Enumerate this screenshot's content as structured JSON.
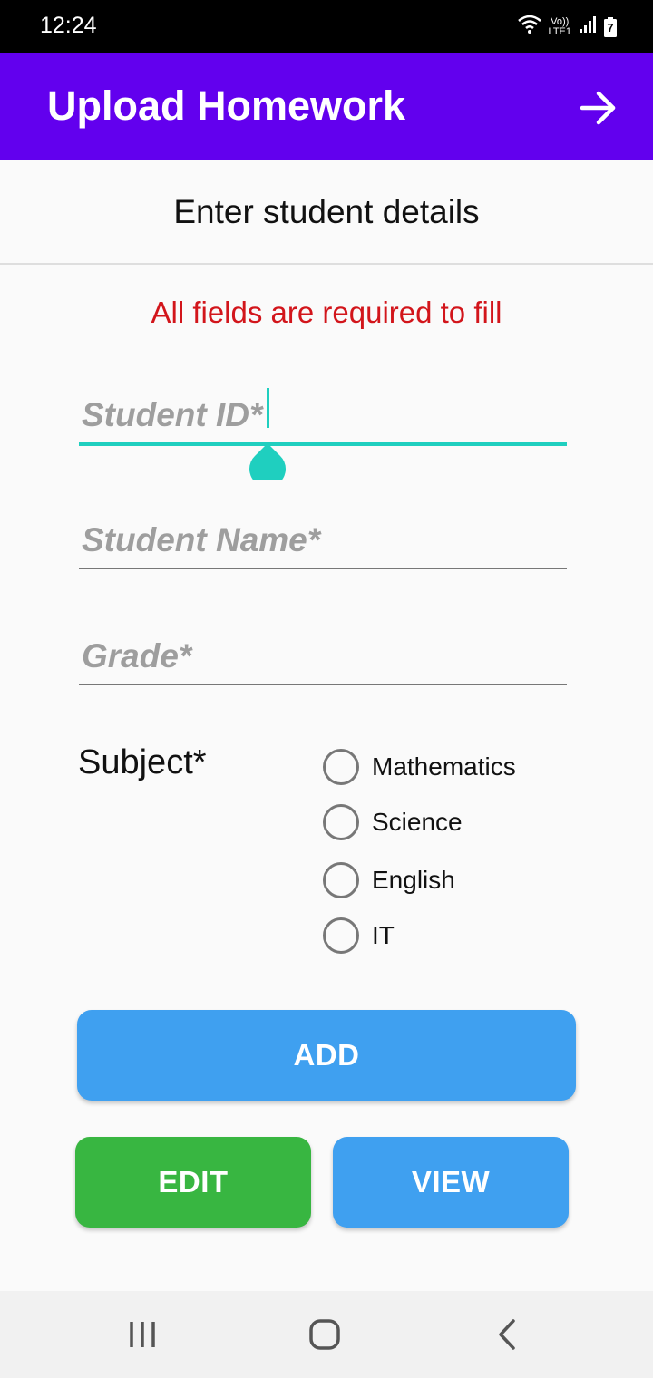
{
  "status_bar": {
    "time": "12:24",
    "icons": [
      "wifi-icon",
      "volte-lte-icon",
      "signal-icon",
      "battery-icon"
    ],
    "volte_text": "Vo))",
    "lte_text": "LTE1",
    "battery_text": "7"
  },
  "app_bar": {
    "title": "Upload Homework",
    "action_icon": "arrow-right-icon",
    "background": "#6200ee"
  },
  "form": {
    "header": "Enter student details",
    "required_note": "All fields are required to fill",
    "student_id_placeholder": "Student ID*",
    "student_name_placeholder": "Student Name*",
    "grade_placeholder": "Grade*",
    "subject_label": "Subject*",
    "subjects": [
      "Mathematics",
      "Science",
      "English",
      "IT"
    ],
    "accent_color": "#1fcfbf",
    "error_color": "#d2151b"
  },
  "buttons": {
    "add": "ADD",
    "edit": "EDIT",
    "view": "VIEW",
    "add_color": "#3fa0f0",
    "edit_color": "#38b641",
    "view_color": "#3fa0f0"
  },
  "nav_bar": {
    "icons": [
      "recents-icon",
      "home-icon",
      "back-icon"
    ]
  }
}
